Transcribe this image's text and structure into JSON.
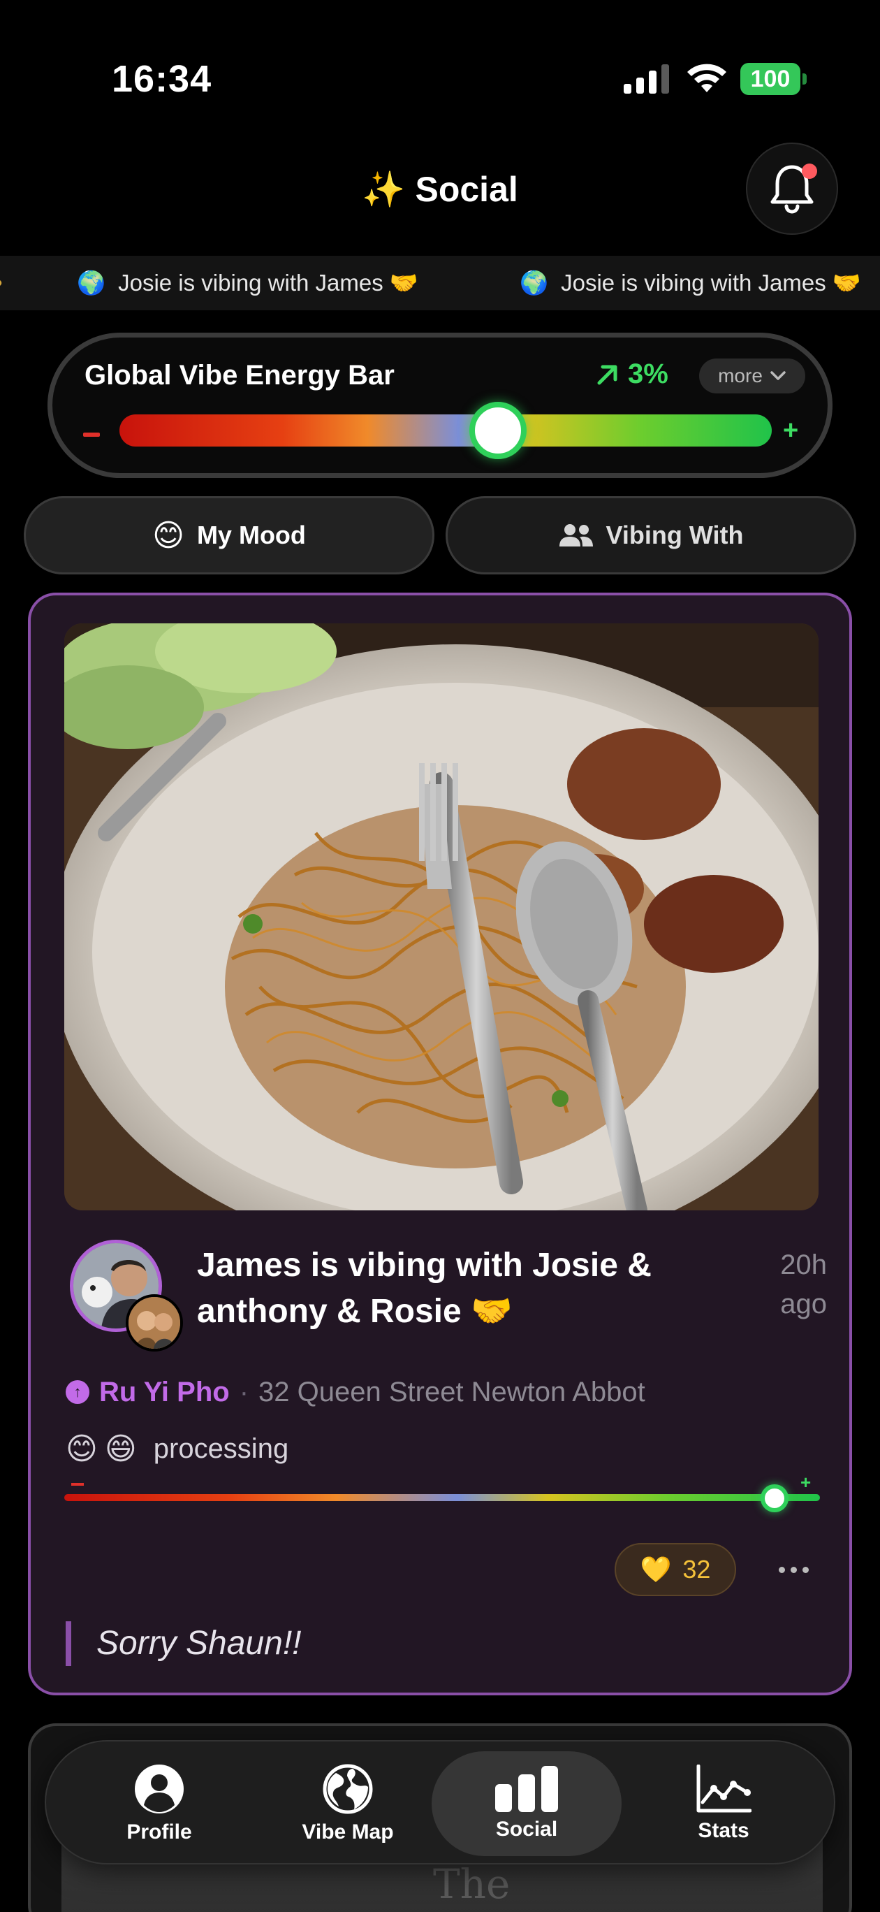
{
  "status_bar": {
    "time": "16:34",
    "battery": "100"
  },
  "header": {
    "title": "Social",
    "title_icon": "sparkles-icon",
    "notification_icon": "bell-icon"
  },
  "ticker": {
    "items": [
      "Josie is vibing with James 🤝",
      "Josie is vibing with James 🤝"
    ]
  },
  "global_vibe": {
    "title": "Global Vibe Energy Bar",
    "change": "3%",
    "more_label": "more",
    "min_symbol": "−",
    "max_symbol": "+",
    "level": 0.58
  },
  "toggles": {
    "my_mood": "My Mood",
    "vibing_with": "Vibing With"
  },
  "post": {
    "headline": "James is vibing with Josie & anthony & Rosie 🤝",
    "time_ago": "20h ago",
    "place_name": "Ru Yi Pho",
    "place_address": "32 Queen Street Newton Abbot",
    "mood_emojis": [
      "😊",
      "😄"
    ],
    "mood_label": "processing",
    "mood_level": 0.94,
    "reaction_emoji": "💛",
    "reaction_count": "32",
    "caption": "Sorry Shaun!!"
  },
  "next_post": {
    "photo_text": "The"
  },
  "tab_bar": {
    "tabs": [
      {
        "label": "Profile",
        "icon": "person-icon"
      },
      {
        "label": "Vibe Map",
        "icon": "globe-icon"
      },
      {
        "label": "Social",
        "icon": "bar-chart-icon"
      },
      {
        "label": "Stats",
        "icon": "line-chart-icon"
      }
    ],
    "active_index": 2
  },
  "colors": {
    "accent_purple": "#b061d6",
    "positive_green": "#3ddc62",
    "negative_red": "#e0302a",
    "card_background": "#221624"
  }
}
